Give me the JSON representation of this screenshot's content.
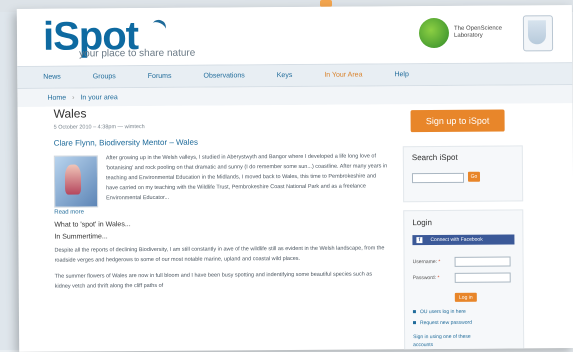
{
  "background": {
    "top_text": "",
    "note": ""
  },
  "header": {
    "logo": "iSpot",
    "tagline": "your place to share nature",
    "partner_1": "The OpenScience Laboratory",
    "partner_2": "The Open University"
  },
  "nav": {
    "items": [
      {
        "label": "News"
      },
      {
        "label": "Groups"
      },
      {
        "label": "Forums"
      },
      {
        "label": "Observations"
      },
      {
        "label": "Keys"
      },
      {
        "label": "In Your Area",
        "active": true
      },
      {
        "label": "Help"
      }
    ]
  },
  "breadcrumb": {
    "home": "Home",
    "sep": "›",
    "current": "In your area"
  },
  "main": {
    "title": "Wales",
    "meta": "5 October 2010 – 4:38pm — wimtech",
    "subhead": "Clare Flynn, Biodiversity Mentor – Wales",
    "post_text": "After growing up in the Welsh valleys, I studied in Aberystwyth and Bangor where I developed a life long love of 'botanising' and rock pooling on that dramatic and sunny (I do remember some sun...) coastline. After many years in teaching and Environmental Education in the Midlands, I moved back to Wales, this time to Pembrokeshire and have carried on my teaching with the Wildlife Trust, Pembrokeshire Coast National Park and as a freelance Environmental Educator...",
    "read_more": "Read more",
    "section_heading": "What to 'spot' in Wales...",
    "season": "In Summertime...",
    "paragraph_1": "Despite all the reports of declining Biodiversity, I am still constantly in awe of the wildlife still as evident in the Welsh landscape, from the roadside verges and hedgerows to some of our most notable marine, upland and coastal wild places.",
    "paragraph_2": "The summer flowers of Wales are now in full bloom and I have been busy spotting and indentifying some beautiful species such as kidney vetch and thrift along the cliff paths of"
  },
  "sidebar": {
    "signup": "Sign up to iSpot",
    "search_title": "Search iSpot",
    "search_button": "Go",
    "login_title": "Login",
    "facebook_button": "Connect with Facebook",
    "username_label": "Username:",
    "password_label": "Password:",
    "required_mark": "*",
    "login_button": "Log in",
    "link_ou": "OU users log in here",
    "link_password": "Request new password",
    "link_accounts": "Sign in using one of these",
    "link_accounts_2": "accounts"
  },
  "colors": {
    "brand_blue": "#0e6aa1",
    "link_blue": "#1f6b9a",
    "accent_orange": "#e8862a",
    "facebook_blue": "#3b5998"
  }
}
